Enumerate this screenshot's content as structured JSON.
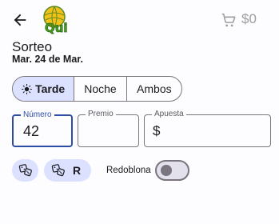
{
  "header": {
    "cart_total": "$0",
    "logo_text": "Qui"
  },
  "draw": {
    "title": "Sorteo",
    "date": "Mar. 24 de Mar."
  },
  "shift_selector": {
    "options": [
      "Tarde",
      "Noche",
      "Ambos"
    ],
    "selected": "Tarde"
  },
  "fields": {
    "numero": {
      "label": "Número",
      "value": "42"
    },
    "premio": {
      "label": "Premio",
      "value": ""
    },
    "apuesta": {
      "label": "Apuesta",
      "prefix": "$",
      "value": ""
    }
  },
  "actions": {
    "dice_r_label": "R"
  },
  "redoblona": {
    "label": "Redoblona",
    "enabled": false
  },
  "colors": {
    "accent": "#2d4ea4",
    "chip_bg": "#dbe1ff",
    "outline": "#7a757f",
    "background": "#fdfcff"
  },
  "icons": [
    "back-arrow-icon",
    "cart-icon",
    "sun-icon",
    "dice-icon"
  ]
}
